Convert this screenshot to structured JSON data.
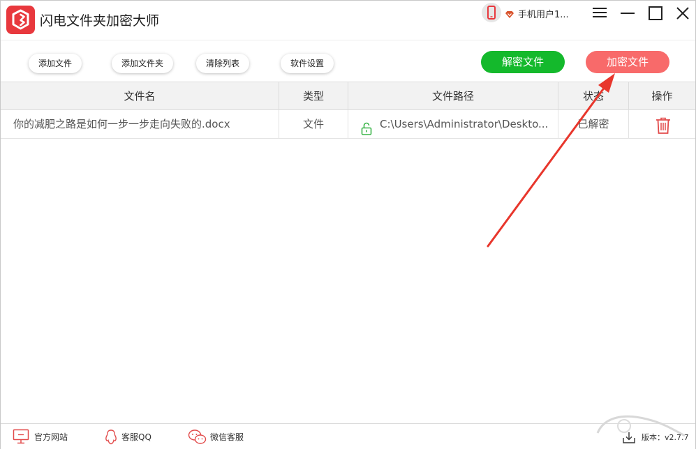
{
  "app": {
    "title": "闪电文件夹加密大师"
  },
  "user": {
    "name": "手机用户1..."
  },
  "toolbar": {
    "add_file": "添加文件",
    "add_folder": "添加文件夹",
    "clear_list": "清除列表",
    "settings": "软件设置",
    "decrypt": "解密文件",
    "encrypt": "加密文件"
  },
  "table": {
    "headers": [
      "文件名",
      "类型",
      "文件路径",
      "状态",
      "操作"
    ],
    "rows": [
      {
        "name": "你的减肥之路是如何一步一步走向失败的.docx",
        "type": "文件",
        "path": "C:\\Users\\Administrator\\Deskto...",
        "status": "已解密"
      }
    ]
  },
  "footer": {
    "website": "官方网站",
    "qq": "客服QQ",
    "wechat": "微信客服",
    "version": "版本：v2.7.7"
  },
  "colors": {
    "brand_red": "#e8383d",
    "decrypt_green": "#14b92c",
    "encrypt_red": "#f86a6a",
    "annotation_red": "#e8362c",
    "lock_green": "#3bb54a",
    "trash_red": "#e24b4b"
  },
  "icons": {
    "logo": "shield-logo-icon",
    "phone": "phone-icon",
    "vip": "vip-diamond-icon",
    "menu": "menu-icon",
    "minimize": "minimize-icon",
    "maximize": "maximize-icon",
    "close": "close-icon",
    "lock": "unlock-icon",
    "delete": "trash-icon",
    "website": "monitor-icon",
    "qq": "qq-penguin-icon",
    "wechat": "wechat-icon",
    "download": "download-icon"
  }
}
